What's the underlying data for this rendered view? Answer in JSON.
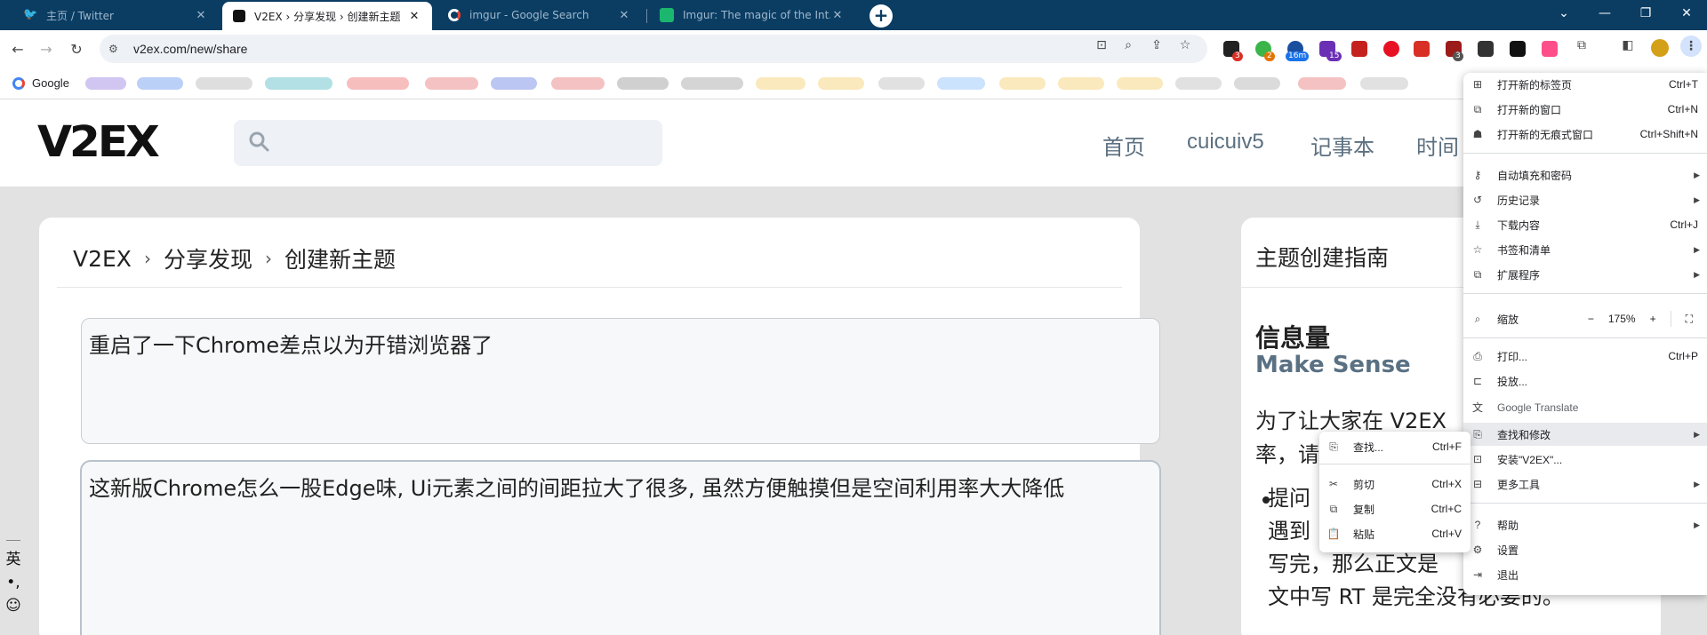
{
  "tabs": [
    {
      "title": "主页 / Twitter",
      "active": false
    },
    {
      "title": "V2EX › 分享发现 › 创建新主题",
      "active": true
    },
    {
      "title": "imgur - Google Search",
      "active": false
    },
    {
      "title": "Imgur: The magic of the Int...",
      "active": false
    }
  ],
  "toolbar": {
    "url": "v2ex.com/new/share",
    "extension_badges": [
      "3",
      "2",
      "16m",
      "15",
      "3"
    ]
  },
  "bookmarks": {
    "google_label": "Google"
  },
  "site": {
    "logo": "V2EX",
    "nav": [
      "首页",
      "cuicuiv5",
      "记事本",
      "时间"
    ]
  },
  "breadcrumb": [
    "V2EX",
    "分享发现",
    "创建新主题"
  ],
  "breadcrumb_sep": "›",
  "editor": {
    "title_value": "重启了一下Chrome差点以为开错浏览器了",
    "content_value": "这新版Chrome怎么一股Edge味, Ui元素之间的间距拉大了很多, 虽然方便触摸但是空间利用率大大降低"
  },
  "sidebar": {
    "title": "主题创建指南",
    "heading": "信息量",
    "subheading": "Make Sense",
    "para": "为了让大家在 V2EX\n率，请",
    "bullet": [
      "提问",
      "遇到",
      "写完，那么正文是",
      "文中写 RT 是完全没有必要的。"
    ]
  },
  "ime": {
    "mode": "英",
    "punct": "•,",
    "emoji": "☺"
  },
  "menu": {
    "items": [
      {
        "label": "打开新的标签页",
        "shortcut": "Ctrl+T",
        "icon": "new-tab-icon"
      },
      {
        "label": "打开新的窗口",
        "shortcut": "Ctrl+N",
        "icon": "new-window-icon"
      },
      {
        "label": "打开新的无痕式窗口",
        "shortcut": "Ctrl+Shift+N",
        "icon": "incognito-icon"
      },
      {
        "label": "自动填充和密码",
        "shortcut": "",
        "icon": "key-icon"
      },
      {
        "label": "历史记录",
        "shortcut": "",
        "icon": "history-icon"
      },
      {
        "label": "下载内容",
        "shortcut": "Ctrl+J",
        "icon": "download-icon"
      },
      {
        "label": "书签和清单",
        "shortcut": "",
        "icon": "star-icon"
      },
      {
        "label": "扩展程序",
        "shortcut": "",
        "icon": "puzzle-icon"
      },
      {
        "label": "缩放",
        "shortcut": "",
        "icon": "zoom-icon"
      },
      {
        "label": "打印...",
        "shortcut": "Ctrl+P",
        "icon": "print-icon"
      },
      {
        "label": "投放...",
        "shortcut": "",
        "icon": "cast-icon"
      },
      {
        "label": "Google Translate",
        "shortcut": "",
        "icon": "translate-icon"
      },
      {
        "label": "查找和修改",
        "shortcut": "",
        "icon": "find-icon"
      },
      {
        "label": "安装\"V2EX\"...",
        "shortcut": "",
        "icon": "install-icon"
      },
      {
        "label": "更多工具",
        "shortcut": "",
        "icon": "tools-icon"
      },
      {
        "label": "帮助",
        "shortcut": "",
        "icon": "help-icon"
      },
      {
        "label": "设置",
        "shortcut": "",
        "icon": "settings-icon"
      },
      {
        "label": "退出",
        "shortcut": "",
        "icon": "exit-icon"
      }
    ],
    "zoom": {
      "minus": "−",
      "value": "175%",
      "plus": "+"
    }
  },
  "submenu": {
    "items": [
      {
        "label": "查找...",
        "shortcut": "Ctrl+F"
      },
      {
        "label": "剪切",
        "shortcut": "Ctrl+X"
      },
      {
        "label": "复制",
        "shortcut": "Ctrl+C"
      },
      {
        "label": "粘贴",
        "shortcut": "Ctrl+V"
      }
    ]
  },
  "colors": {
    "tabstrip": "#0b3d63",
    "accent": "#5a7184"
  }
}
